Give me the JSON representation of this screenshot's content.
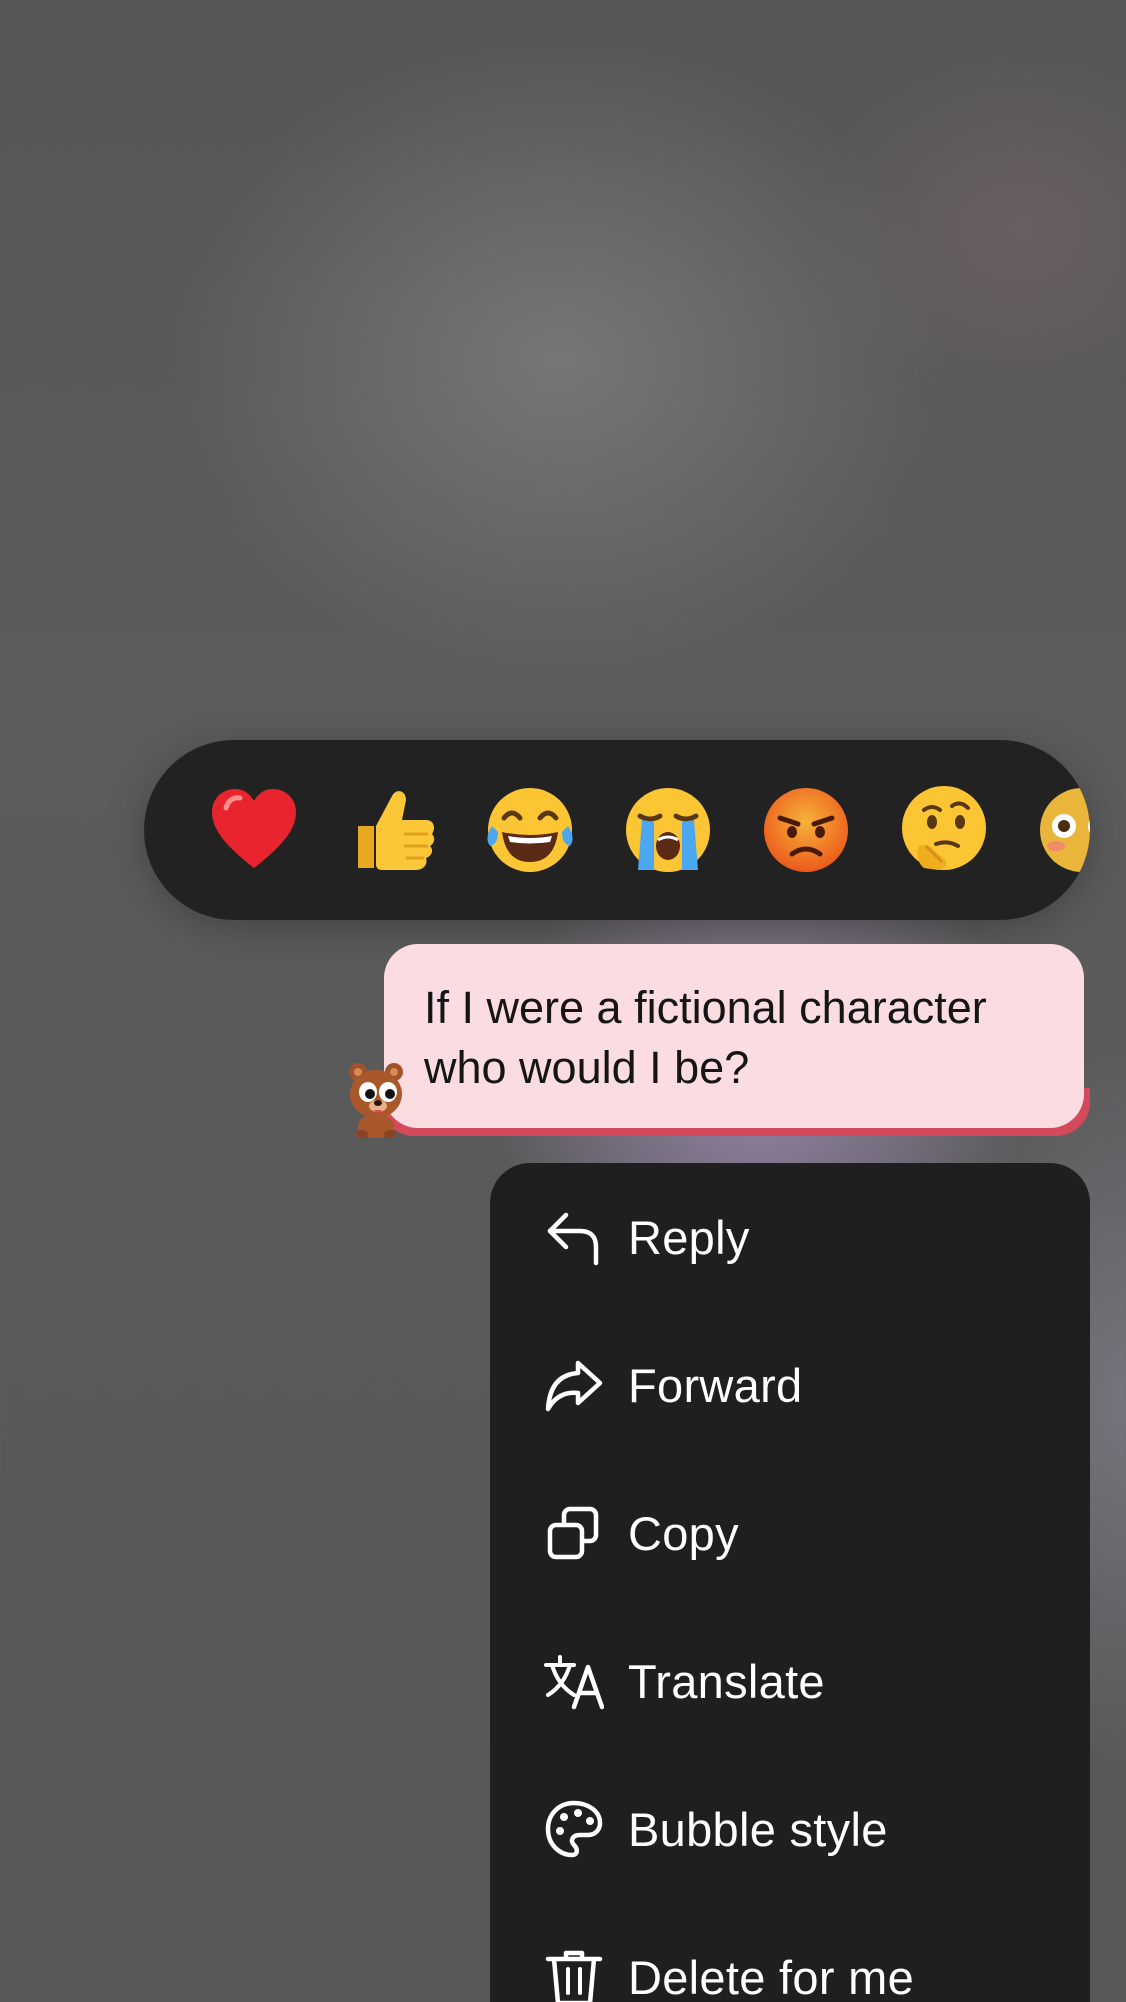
{
  "reactions": [
    {
      "name": "red-heart",
      "glyph": "heart"
    },
    {
      "name": "thumbs-up",
      "glyph": "thumbs-up"
    },
    {
      "name": "tears-of-joy",
      "glyph": "laughing"
    },
    {
      "name": "loudly-crying",
      "glyph": "crying"
    },
    {
      "name": "angry",
      "glyph": "angry"
    },
    {
      "name": "thinking",
      "glyph": "thinking"
    },
    {
      "name": "flushed-partial",
      "glyph": "flushed"
    }
  ],
  "message": {
    "line1": "If I were a fictional character",
    "line2": "who would I be?",
    "bubble_color": "#fbdde1",
    "accent_color": "#d44a5a"
  },
  "menu": {
    "items": [
      {
        "label": "Reply",
        "icon": "reply-icon"
      },
      {
        "label": "Forward",
        "icon": "forward-icon"
      },
      {
        "label": "Copy",
        "icon": "copy-icon"
      },
      {
        "label": "Translate",
        "icon": "translate-icon"
      },
      {
        "label": "Bubble style",
        "icon": "palette-icon"
      },
      {
        "label": "Delete for me",
        "icon": "trash-icon"
      }
    ]
  }
}
